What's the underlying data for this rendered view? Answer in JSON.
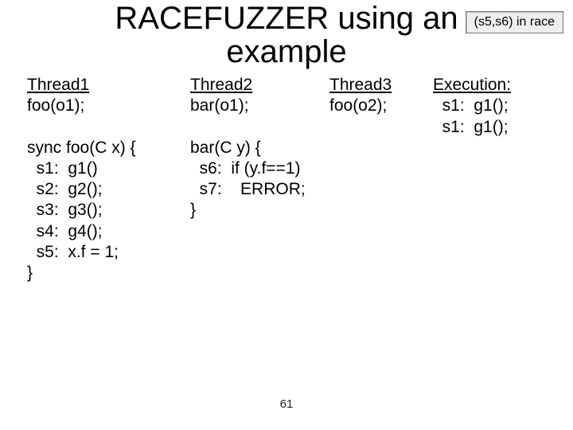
{
  "title_line1": "RACEFUZZER using an",
  "title_line2": "example",
  "badge": "(s5,s6) in race",
  "col1": {
    "header": "Thread1",
    "call": "foo(o1);",
    "body": [
      "sync foo(C x) {",
      "  s1:  g1()",
      "  s2:  g2();",
      "  s3:  g3();",
      "  s4:  g4();",
      "  s5:  x.f = 1;",
      "}"
    ]
  },
  "col2": {
    "header": "Thread2",
    "call": "bar(o1);",
    "body": [
      "bar(C y) {",
      "  s6:  if (y.f==1)",
      "  s7:    ERROR;",
      "}"
    ]
  },
  "col3": {
    "header": "Thread3",
    "call": "foo(o2);"
  },
  "col4": {
    "header": "Execution:",
    "lines": [
      "  s1:  g1();",
      "  s1:  g1();"
    ]
  },
  "page": "61"
}
